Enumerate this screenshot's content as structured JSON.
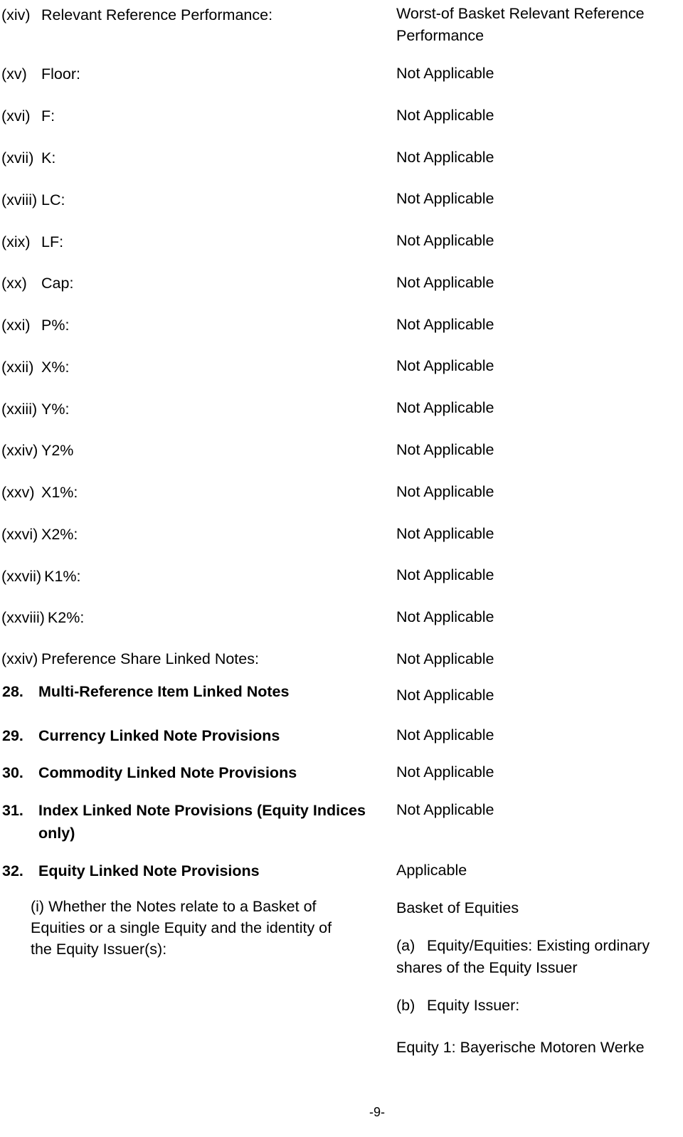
{
  "document": {
    "page_footer": "-9-"
  },
  "roman_rows": [
    {
      "num": "(xiv)",
      "label": "Relevant Reference Performance:",
      "value": "Worst-of Basket Relevant Reference Performance"
    },
    {
      "num": "(xv)",
      "label": "Floor:",
      "value": "Not Applicable"
    },
    {
      "num": "(xvi)",
      "label": "F:",
      "value": "Not Applicable"
    },
    {
      "num": "(xvii)",
      "label": "K:",
      "value": "Not Applicable"
    },
    {
      "num": "(xviii)",
      "label": "LC:",
      "value": "Not Applicable"
    },
    {
      "num": "(xix)",
      "label": "LF:",
      "value": "Not Applicable"
    },
    {
      "num": "(xx)",
      "label": "Cap:",
      "value": "Not Applicable"
    },
    {
      "num": "(xxi)",
      "label": "P%:",
      "value": "Not Applicable"
    },
    {
      "num": "(xxii)",
      "label": "X%:",
      "value": "Not Applicable"
    },
    {
      "num": "(xxiii)",
      "label": "Y%:",
      "value": "Not Applicable"
    },
    {
      "num": "(xxiv)",
      "label": "Y2%",
      "value": "Not Applicable"
    },
    {
      "num": "(xxv)",
      "label": "X1%:",
      "value": "Not Applicable"
    },
    {
      "num": "(xxvi)",
      "label": "X2%:",
      "value": "Not Applicable"
    },
    {
      "num": "(xxvii)",
      "label": "K1%:",
      "value": "Not Applicable"
    },
    {
      "num": "(xxviii)",
      "label": "K2%:",
      "value": "Not Applicable"
    },
    {
      "num": "(xxiv)",
      "label": "Preference Share Linked Notes:",
      "value": "Not Applicable"
    }
  ],
  "numbered_rows": [
    {
      "num": "28.",
      "label": "Multi-Reference Item Linked Notes",
      "value": "Not Applicable"
    },
    {
      "num": "29.",
      "label": "Currency Linked Note Provisions",
      "value": "Not Applicable"
    },
    {
      "num": "30.",
      "label": "Commodity Linked Note Provisions",
      "value": "Not Applicable"
    },
    {
      "num": "31.",
      "label": "Index Linked Note Provisions (Equity Indices only)",
      "value": "Not Applicable"
    },
    {
      "num": "32.",
      "label": "Equity Linked Note Provisions",
      "value": "Applicable"
    }
  ],
  "equity_section": {
    "sub_item_i": "(i) Whether the Notes relate to a Basket of Equities or a single Equity and the identity of the Equity Issuer(s):",
    "basket_value": "Basket of Equities",
    "item_a_tag": "(a)",
    "item_a_text": "Equity/Equities: Existing ordinary shares of the Equity Issuer",
    "item_b_tag": "(b)",
    "item_b_text": "Equity Issuer:",
    "equity_1": "Equity 1: Bayerische Motoren Werke"
  }
}
